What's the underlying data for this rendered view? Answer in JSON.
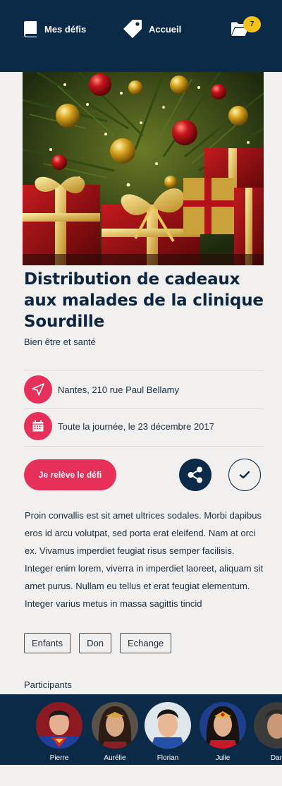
{
  "topbar": {
    "nav": [
      {
        "label": "Mes défis",
        "icon": "book-icon"
      },
      {
        "label": "Accueil",
        "icon": "tag-icon"
      }
    ],
    "notifications": {
      "icon": "folder-icon",
      "count": "7"
    }
  },
  "challenge": {
    "title": "Distribution de cadeaux aux malades de la clinique Sourdille",
    "category": "Bien être et santé",
    "location": "Nantes, 210 rue Paul Bellamy",
    "date": "Toute la journée, le 23 décembre 2017",
    "cta_label": "Je relève le défi",
    "description": "Proin convallis est sit amet ultrices sodales. Morbi dapibus eros id arcu volutpat, sed porta erat eleifend. Nam at orci ex. Vivamus imperdiet feugiat risus semper facilisis. Integer enim lorem, viverra in imperdiet laoreet, aliquam sit amet purus. Nullam eu tellus et erat feugiat elementum. Integer varius metus in massa sagittis tincid",
    "tags": [
      "Enfants",
      "Don",
      "Echange"
    ]
  },
  "participants": {
    "label": "Participants",
    "people": [
      {
        "name": "Pierre"
      },
      {
        "name": "Aurélie"
      },
      {
        "name": "Florian"
      },
      {
        "name": "Julie"
      },
      {
        "name": "Dan"
      }
    ]
  },
  "colors": {
    "navy": "#0b2a47",
    "accent": "#e6305a",
    "badge": "#f6c315",
    "background": "#f1f0ef"
  }
}
